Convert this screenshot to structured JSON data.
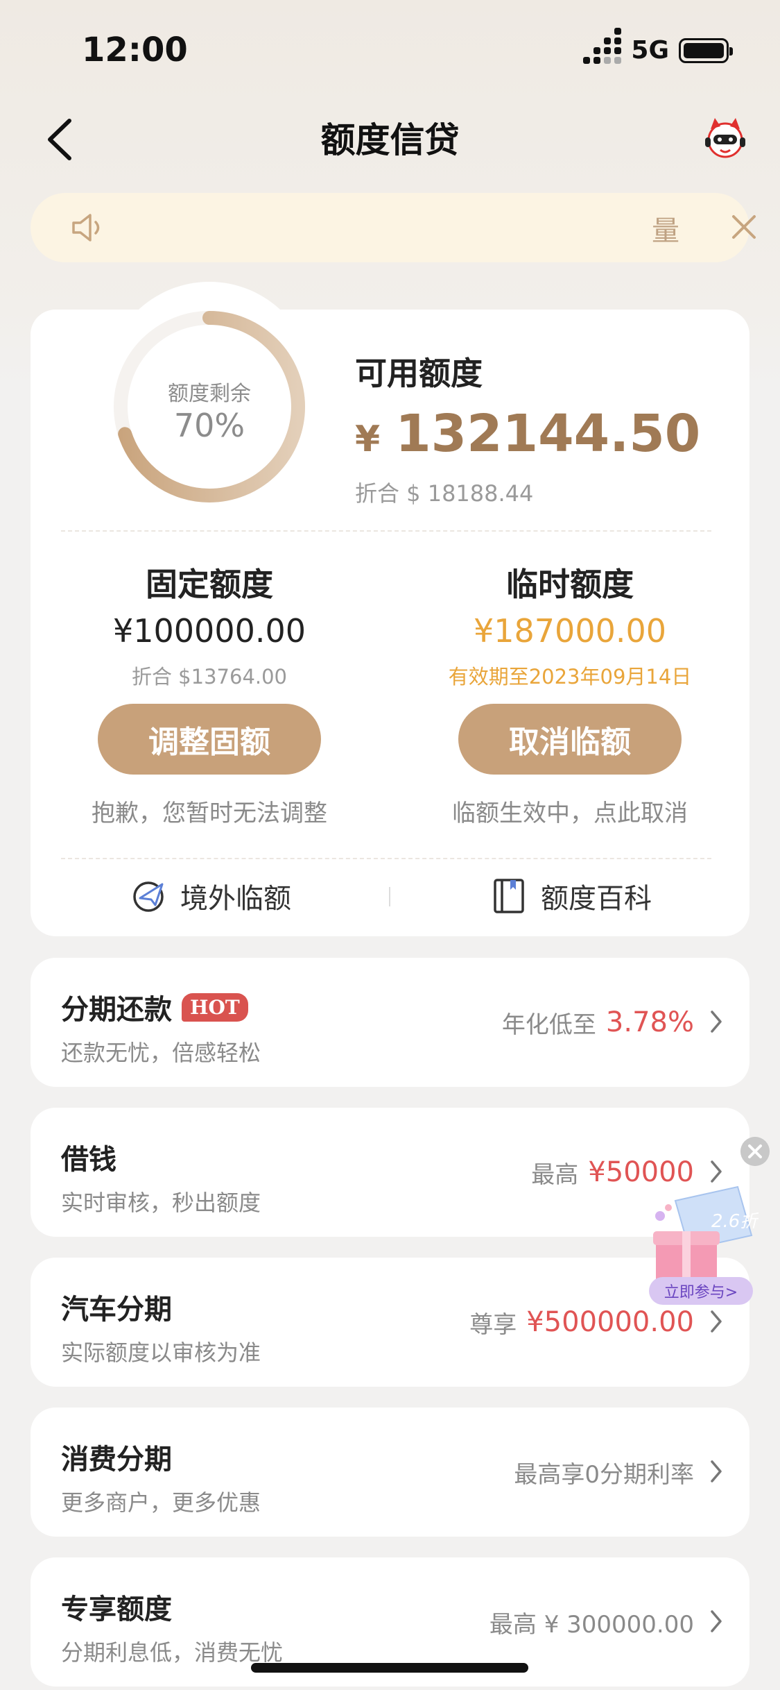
{
  "status_bar": {
    "time": "12:00",
    "network": "5G"
  },
  "nav": {
    "title": "额度信贷"
  },
  "notice": {
    "text": "量"
  },
  "credit": {
    "ring_label": "额度剩余",
    "ring_percent": "70%",
    "ring_fraction": 0.7,
    "available_label": "可用额度",
    "available_currency": "¥",
    "available_amount": "132144.50",
    "available_usd": "折合 $ 18188.44",
    "fixed": {
      "title": "固定额度",
      "amount": "¥100000.00",
      "sub": "折合 $13764.00",
      "button": "调整固额",
      "note": "抱歉，您暂时无法调整"
    },
    "temporary": {
      "title": "临时额度",
      "amount": "¥187000.00",
      "sub": "有效期至2023年09月14日",
      "button": "取消临额",
      "note": "临额生效中，点此取消"
    },
    "links": {
      "overseas": "境外临额",
      "wiki": "额度百科"
    }
  },
  "colors": {
    "gold": "#c8a17a",
    "orange": "#e9a53a",
    "red": "#e05454",
    "accent_text": "#a07a55"
  },
  "list": [
    {
      "title": "分期还款",
      "badge": "HOT",
      "sub": "还款无忧，倍感轻松",
      "prefix": "年化低至",
      "value": "3.78%"
    },
    {
      "title": "借钱",
      "sub": "实时审核，秒出额度",
      "prefix": "最高",
      "value": "¥50000"
    },
    {
      "title": "汽车分期",
      "sub": "实际额度以审核为准",
      "prefix": "尊享",
      "value": "¥500000.00"
    },
    {
      "title": "消费分期",
      "sub": "更多商户，更多优惠",
      "prefix": "最高享0分期利率",
      "value": ""
    },
    {
      "title": "专享额度",
      "sub": "分期利息低，消费无忧",
      "prefix": "最高 ¥ 300000.00",
      "value": ""
    }
  ],
  "promo": {
    "discount": "2.6折",
    "button": "立即参与>"
  }
}
